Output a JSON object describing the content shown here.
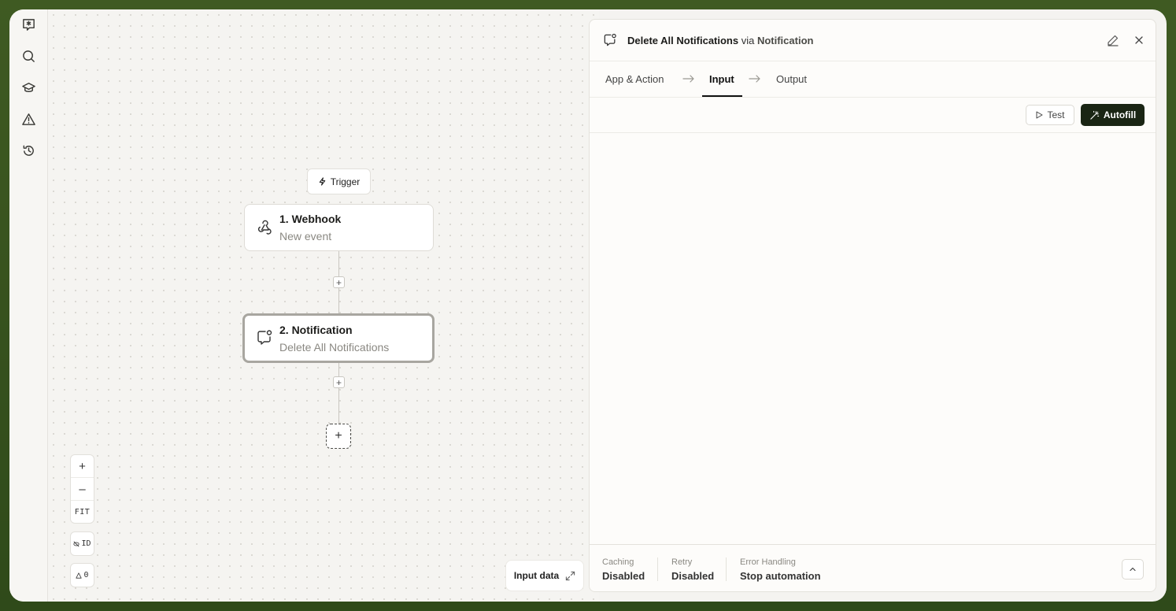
{
  "rail": {
    "items": [
      {
        "name": "chat-star-icon"
      },
      {
        "name": "search-icon"
      },
      {
        "name": "graduation-cap-icon"
      },
      {
        "name": "warning-icon"
      },
      {
        "name": "history-icon"
      }
    ]
  },
  "canvas": {
    "trigger_label": "Trigger",
    "nodes": [
      {
        "title": "1. Webhook",
        "subtitle": "New event",
        "icon": "webhook-icon"
      },
      {
        "title": "2. Notification",
        "subtitle": "Delete All Notifications",
        "icon": "notification-icon"
      }
    ],
    "zoom_in": "+",
    "zoom_out": "–",
    "fit": "FIT",
    "id_toggle": "ID",
    "warnings_count": "0",
    "input_data": "Input data"
  },
  "panel": {
    "title_action": "Delete All Notifications",
    "title_via": " via ",
    "title_app": "Notification",
    "tabs": [
      {
        "label": "App & Action"
      },
      {
        "label": "Input"
      },
      {
        "label": "Output"
      }
    ],
    "active_tab": "Input",
    "test_label": "Test",
    "autofill_label": "Autofill",
    "footer": {
      "caching_label": "Caching",
      "caching_value": "Disabled",
      "retry_label": "Retry",
      "retry_value": "Disabled",
      "error_label": "Error Handling",
      "error_value": "Stop automation"
    }
  },
  "colors": {
    "accent_dark": "#1a2514",
    "background_outer": "#3f5a22"
  }
}
